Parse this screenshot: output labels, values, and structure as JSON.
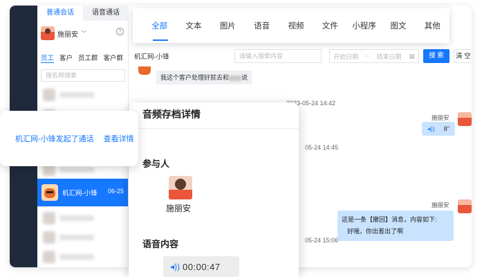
{
  "sidebar": {
    "top_tabs": [
      "普通会话",
      "语音通话"
    ],
    "user_name": "施丽安",
    "help_icon": "question-circle-icon",
    "sub_tabs": [
      "员工",
      "客户",
      "员工群",
      "客户群"
    ],
    "search_placeholder": "搜名称搜索",
    "selected_contact": {
      "name": "机汇网-小锋",
      "date": "06-25"
    }
  },
  "filter_tabs": [
    "全部",
    "文本",
    "图片",
    "语音",
    "视频",
    "文件",
    "小程序",
    "图文",
    "其他"
  ],
  "chat": {
    "title": "机汇网-小锋",
    "keyword_placeholder": "请输入搜索内容",
    "start_date_placeholder": "开始日期",
    "range_sep": "~",
    "end_date_placeholder": "结束日期",
    "search_button": "搜 索",
    "clear_button": "清 空",
    "first_message_a": "我这个客户处理好就去和",
    "first_message_b": "说",
    "messages": [
      {
        "time": "2023-05-24 14:42",
        "sender": "施丽安",
        "voice_duration": "8\""
      },
      {
        "time": "05-24 14:45"
      },
      {
        "sender": "施丽安",
        "recall_line1": "这是一条【撤回】消息，内容如下:",
        "recall_line2": "好哦，你出差出了啊"
      },
      {
        "time": "05-24 15:06"
      }
    ]
  },
  "notify": {
    "text": "机汇网-小锋发起了通话",
    "link": "查看详情"
  },
  "detail": {
    "title": "音频存档详情",
    "participants_label": "参与人",
    "participant_name": "施丽安",
    "content_label": "语音内容",
    "voice_time": "00:00:47",
    "voice_icon": "sound-wave-icon"
  },
  "colors": {
    "accent": "#1677ff",
    "bubble": "#c9e3ff",
    "dark_nav": "#1f2b3d"
  }
}
